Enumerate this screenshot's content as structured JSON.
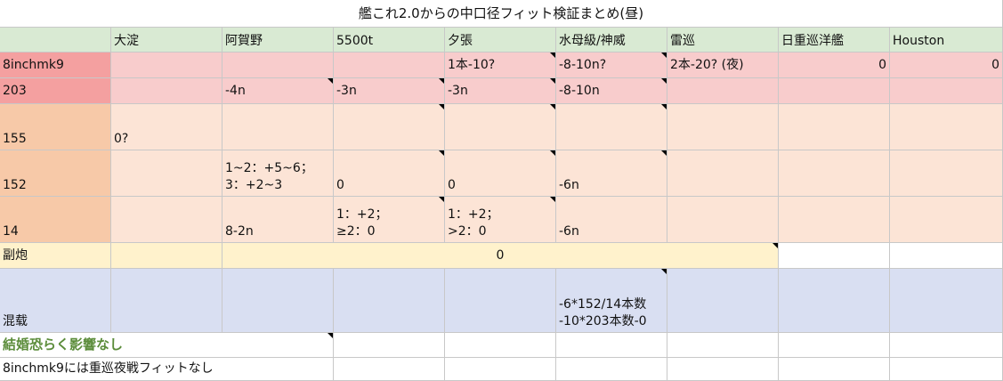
{
  "title": "艦これ2.0からの中口径フィット検証まとめ(昼)",
  "colors": {
    "header_bg": "#d9ead3",
    "row_red_label": "#f4a0a0",
    "row_red": "#f8cccc",
    "row_orange_label": "#f7c9a8",
    "row_orange": "#fce4d6",
    "row_yellow": "#fff2cc",
    "row_blue": "#d9dff2",
    "green_text": "#5b8c3a"
  },
  "headers": [
    "大淀",
    "阿賀野",
    "5500t",
    "夕張",
    "水母級/神威",
    "雷巡",
    "日重巡洋艦",
    "Houston"
  ],
  "rows": {
    "r8inch": {
      "label": "8inchmk9",
      "cells": [
        "",
        "",
        "",
        "1本-10?",
        "-8-10n?",
        "2本-20? (夜)",
        "0",
        "0"
      ]
    },
    "r203": {
      "label": "203",
      "cells": [
        "",
        "-4n",
        "-3n",
        "-3n",
        "-8-10n",
        "",
        "",
        ""
      ]
    },
    "r155": {
      "label": "155",
      "cells": [
        "0?",
        "",
        "",
        "",
        "",
        "",
        "",
        ""
      ]
    },
    "r152": {
      "label": "152",
      "cells": [
        "",
        "1~2：+5~6；\n3：+2~3",
        "0",
        "0",
        "-6n",
        "",
        "",
        ""
      ]
    },
    "r14": {
      "label": "14",
      "cells": [
        "",
        "8-2n",
        "1：+2；\n≥2：0",
        "1：+2；\n>2：0",
        "-6n",
        "",
        "",
        ""
      ]
    },
    "rsub": {
      "label": "副炮",
      "first": "",
      "merged": "0"
    },
    "rmix": {
      "label": "混载",
      "cells": [
        "",
        "",
        "",
        "",
        "-6*152/14本数\n-10*203本数-0",
        "",
        "",
        ""
      ]
    }
  },
  "notes": {
    "marriage": "結婚恐らく影響なし",
    "night": "8inchmk9には重巡夜戦フィットなし"
  }
}
